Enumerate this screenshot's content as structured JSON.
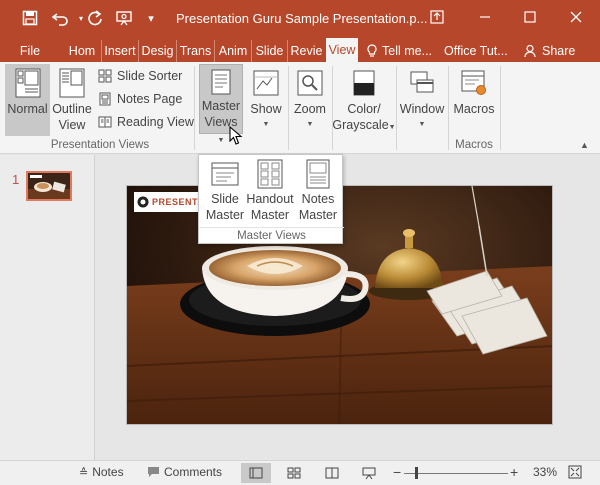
{
  "window": {
    "title": "Presentation Guru Sample Presentation.p...",
    "colors": {
      "accent": "#b7472a",
      "ribbon": "#f4f4f4",
      "thumb_border": "#e07a5f"
    }
  },
  "quick_access": {
    "icons": [
      "save-icon",
      "undo-icon",
      "redo-icon",
      "present-icon",
      "customize-icon"
    ]
  },
  "tabs": [
    {
      "label": "File"
    },
    {
      "label": "Hom"
    },
    {
      "label": "Insert"
    },
    {
      "label": "Desig"
    },
    {
      "label": "Trans"
    },
    {
      "label": "Anim"
    },
    {
      "label": "Slide"
    },
    {
      "label": "Revie"
    },
    {
      "label": "View"
    },
    {
      "label": "Tell me..."
    },
    {
      "label": "Office Tut..."
    },
    {
      "label": "Share"
    }
  ],
  "ribbon": {
    "presentation_views": {
      "group_label": "Presentation Views",
      "normal": "Normal",
      "outline_view_line1": "Outline",
      "outline_view_line2": "View",
      "slide_sorter": "Slide Sorter",
      "notes_page": "Notes Page",
      "reading_view": "Reading View"
    },
    "master_views": {
      "label_line1": "Master",
      "label_line2": "Views"
    },
    "show": "Show",
    "zoom": "Zoom",
    "color_grayscale": {
      "line1": "Color/",
      "line2": "Grayscale"
    },
    "window": "Window",
    "macros": {
      "button": "Macros",
      "group_label": "Macros"
    }
  },
  "dropdown": {
    "items": [
      {
        "line1": "Slide",
        "line2": "Master"
      },
      {
        "line1": "Handout",
        "line2": "Master"
      },
      {
        "line1": "Notes",
        "line2": "Master"
      }
    ],
    "group_label": "Master Views"
  },
  "thumbnails": {
    "slide_number": "1"
  },
  "slide": {
    "badge_text": "PRESENTA"
  },
  "statusbar": {
    "notes": "Notes",
    "comments": "Comments",
    "zoom_level": "33%",
    "zoom_fraction": 0.12
  }
}
